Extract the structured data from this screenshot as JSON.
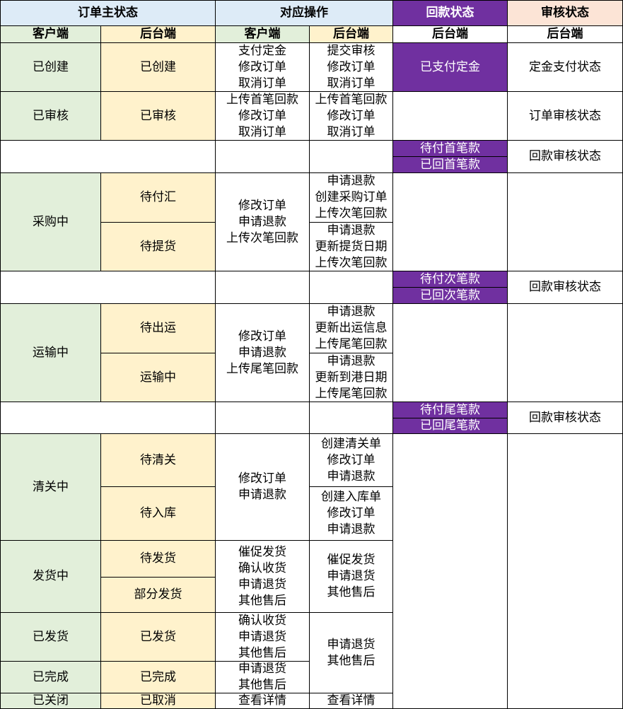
{
  "colors": {
    "green": "#E2EFDA",
    "yellow": "#FFF2CC",
    "blue": "#DDEBF7",
    "purple": "#7030A0",
    "peach": "#FCE4D6",
    "white": "#FFFFFF",
    "border": "#000000"
  },
  "header": {
    "main_status": "订单主状态",
    "operations": "对应操作",
    "payment_status": "回款状态",
    "review_status": "审核状态",
    "client": "客户端",
    "backend": "后台端"
  },
  "rows": {
    "created": {
      "client_status": "已创建",
      "backend_status": "已创建",
      "client_ops": "支付定金\n修改订单\n取消订单",
      "backend_ops": "提交审核\n修改订单\n取消订单",
      "payment": "已支付定金",
      "review": "定金支付状态"
    },
    "reviewed": {
      "client_status": "已审核",
      "backend_status": "已审核",
      "client_ops": "上传首笔回款\n修改订单\n取消订单",
      "backend_ops": "上传首笔回款\n修改订单\n取消订单",
      "review": "订单审核状态"
    },
    "first_payment": {
      "pending": "待付首笔款",
      "returned": "已回首笔款",
      "review": "回款审核状态"
    },
    "purchasing": {
      "client_status": "采购中",
      "sub1": "待付汇",
      "sub2": "待提货",
      "client_ops": "修改订单\n申请退款\n上传次笔回款",
      "backend_ops_1": "申请退款\n创建采购订单\n上传次笔回款",
      "backend_ops_2": "申请退款\n更新提货日期\n上传次笔回款"
    },
    "second_payment": {
      "pending": "待付次笔款",
      "returned": "已回次笔款",
      "review": "回款审核状态"
    },
    "shipping": {
      "client_status": "运输中",
      "sub1": "待出运",
      "sub2": "运输中",
      "client_ops": "修改订单\n申请退款\n上传尾笔回款",
      "backend_ops_1": "申请退款\n更新出运信息\n上传尾笔回款",
      "backend_ops_2": "申请退款\n更新到港日期\n上传尾笔回款"
    },
    "final_payment": {
      "pending": "待付尾笔款",
      "returned": "已回尾笔款",
      "review": "回款审核状态"
    },
    "customs": {
      "client_status": "清关中",
      "sub1": "待清关",
      "sub2": "待入库",
      "client_ops": "修改订单\n申请退款",
      "backend_ops_1": "创建清关单\n修改订单\n申请退款",
      "backend_ops_2": "创建入库单\n修改订单\n申请退款"
    },
    "delivering": {
      "client_status": "发货中",
      "sub1": "待发货",
      "sub2": "部分发货",
      "client_ops": "催促发货\n确认收货\n申请退货\n其他售后",
      "backend_ops": "催促发货\n申请退货\n其他售后"
    },
    "shipped": {
      "client_status": "已发货",
      "backend_status": "已发货",
      "client_ops": "确认收货\n申请退货\n其他售后",
      "backend_ops": "申请退货\n其他售后"
    },
    "completed": {
      "client_status": "已完成",
      "backend_status": "已完成",
      "client_ops": "申请退货\n其他售后"
    },
    "closed": {
      "client_status": "已关闭",
      "backend_status": "已取消",
      "client_ops": "查看详情",
      "backend_ops": "查看详情"
    }
  }
}
